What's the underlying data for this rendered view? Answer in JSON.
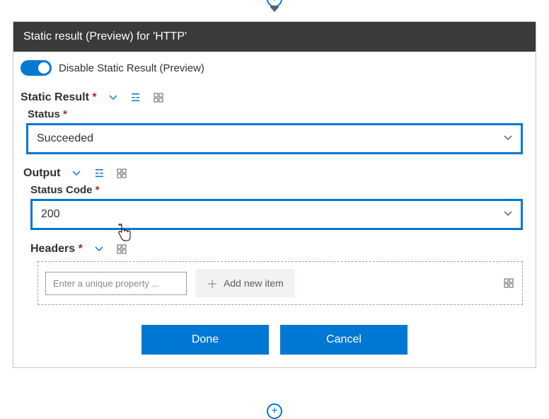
{
  "dialog": {
    "title": "Static result (Preview) for 'HTTP'"
  },
  "toggle": {
    "label": "Disable Static Result (Preview)"
  },
  "staticResult": {
    "label": "Static Result",
    "required": "*"
  },
  "status": {
    "label": "Status",
    "required": "*",
    "value": "Succeeded"
  },
  "output": {
    "label": "Output"
  },
  "statusCode": {
    "label": "Status Code",
    "required": "*",
    "value": "200"
  },
  "headers": {
    "label": "Headers",
    "required": "*",
    "placeholder": "Enter a unique property ...",
    "addItem": "Add new item"
  },
  "buttons": {
    "done": "Done",
    "cancel": "Cancel"
  }
}
